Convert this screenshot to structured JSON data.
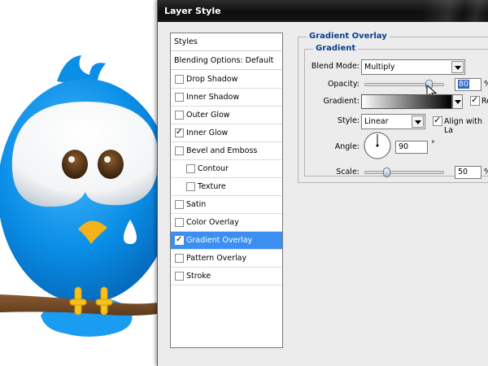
{
  "dialog": {
    "title": "Layer Style"
  },
  "style_list": {
    "header": "Styles",
    "blending_options": "Blending Options: Default",
    "items": [
      {
        "label": "Drop Shadow",
        "checked": false
      },
      {
        "label": "Inner Shadow",
        "checked": false
      },
      {
        "label": "Outer Glow",
        "checked": false
      },
      {
        "label": "Inner Glow",
        "checked": true
      },
      {
        "label": "Bevel and Emboss",
        "checked": false
      },
      {
        "label": "Contour",
        "checked": false
      },
      {
        "label": "Texture",
        "checked": false
      },
      {
        "label": "Satin",
        "checked": false
      },
      {
        "label": "Color Overlay",
        "checked": false
      },
      {
        "label": "Gradient Overlay",
        "checked": true,
        "selected": true
      },
      {
        "label": "Pattern Overlay",
        "checked": false
      },
      {
        "label": "Stroke",
        "checked": false
      }
    ]
  },
  "panel": {
    "section_title": "Gradient Overlay",
    "group_title": "Gradient",
    "blend_mode": {
      "label": "Blend Mode:",
      "value": "Multiply"
    },
    "opacity": {
      "label": "Opacity:",
      "value": "80",
      "unit": "%"
    },
    "gradient": {
      "label": "Gradient:",
      "reverse_label": "Re",
      "reverse_checked": true
    },
    "style": {
      "label": "Style:",
      "value": "Linear",
      "align_label": "Align with La",
      "align_checked": true
    },
    "angle": {
      "label": "Angle:",
      "value": "90",
      "unit": "°"
    },
    "scale": {
      "label": "Scale:",
      "value": "50",
      "unit": "%"
    }
  },
  "colors": {
    "selection_blue": "#3b8ff0",
    "bird_blue": "#0a8ee6",
    "title_text": "#0a3e8f"
  },
  "icons": {
    "tick": "✓",
    "degree": "°"
  }
}
